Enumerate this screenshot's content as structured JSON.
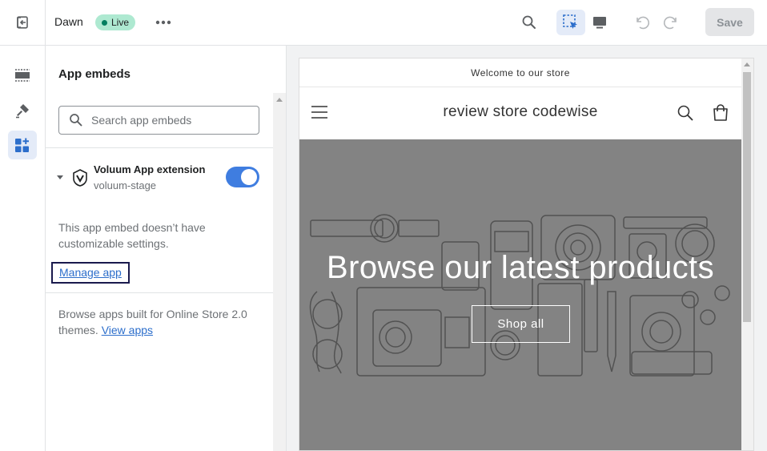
{
  "topbar": {
    "theme_name": "Dawn",
    "status_badge": "Live",
    "save_label": "Save"
  },
  "panel": {
    "title": "App embeds",
    "search_placeholder": "Search app embeds",
    "extension": {
      "name": "Voluum App extension",
      "handle": "voluum-stage",
      "enabled": true
    },
    "no_settings_note": "This app embed doesn’t have customizable settings.",
    "manage_link": "Manage app",
    "browse_note": "Browse apps built for Online Store 2.0 themes.",
    "view_apps_link": "View apps"
  },
  "preview": {
    "announcement": "Welcome to our store",
    "store_name": "review store codewise",
    "hero_title": "Browse our latest products",
    "hero_button": "Shop all"
  },
  "colors": {
    "accent": "#3f7de0",
    "link": "#2c6ecb",
    "live_badge": "#aee9d1",
    "hero_bg": "#838383"
  }
}
